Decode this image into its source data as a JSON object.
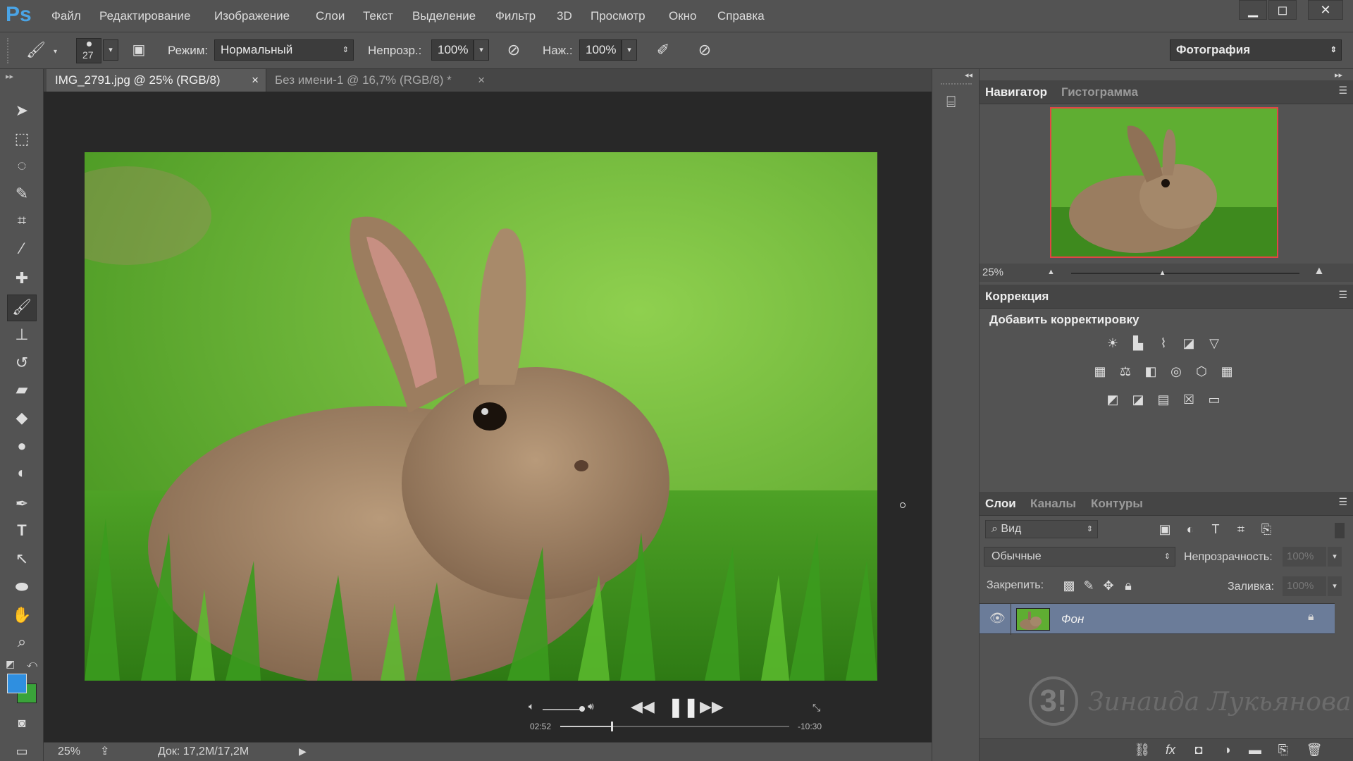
{
  "app": {
    "logo": "Ps"
  },
  "menu": [
    "Файл",
    "Редактирование",
    "Изображение",
    "Слои",
    "Текст",
    "Выделение",
    "Фильтр",
    "3D",
    "Просмотр",
    "Окно",
    "Справка"
  ],
  "window_controls": {
    "minimize": "▁",
    "maximize": "◻",
    "close": "✕"
  },
  "options": {
    "brush_size": "27",
    "mode_label": "Режим:",
    "mode_value": "Нормальный",
    "opacity_label": "Непрозр.:",
    "opacity_value": "100%",
    "pressure_label": "Наж.:",
    "pressure_value": "100%",
    "workspace": "Фотография"
  },
  "tabs": [
    {
      "label": "IMG_2791.jpg @ 25% (RGB/8)",
      "close": "×"
    },
    {
      "label": "Без имени-1 @ 16,7% (RGB/8) *",
      "close": "×"
    }
  ],
  "video": {
    "elapsed": "02:52",
    "remaining": "-10:30",
    "progress": 0.22
  },
  "status": {
    "zoom": "25%",
    "doc": "Док: 17,2M/17,2M"
  },
  "navigator": {
    "tab1": "Навигатор",
    "tab2": "Гистограмма",
    "zoom": "25%",
    "slider_value": 0.4
  },
  "correction": {
    "title": "Коррекция",
    "subtitle": "Добавить корректировку"
  },
  "layers": {
    "tab1": "Слои",
    "tab2": "Каналы",
    "tab3": "Контуры",
    "filter_kind": "Вид",
    "blend_mode": "Обычные",
    "opacity_label": "Непрозрачность:",
    "opacity_value": "100%",
    "lock_label": "Закрепить:",
    "fill_label": "Заливка:",
    "fill_value": "100%",
    "layer_name": "Фон"
  },
  "watermark": {
    "signature": "Зинаида Лукьянова"
  },
  "colors": {
    "foreground": "#2f8fe0",
    "background": "#3aa33a",
    "accent": "#4aa4e6",
    "selected_layer": "#6b7c99"
  }
}
